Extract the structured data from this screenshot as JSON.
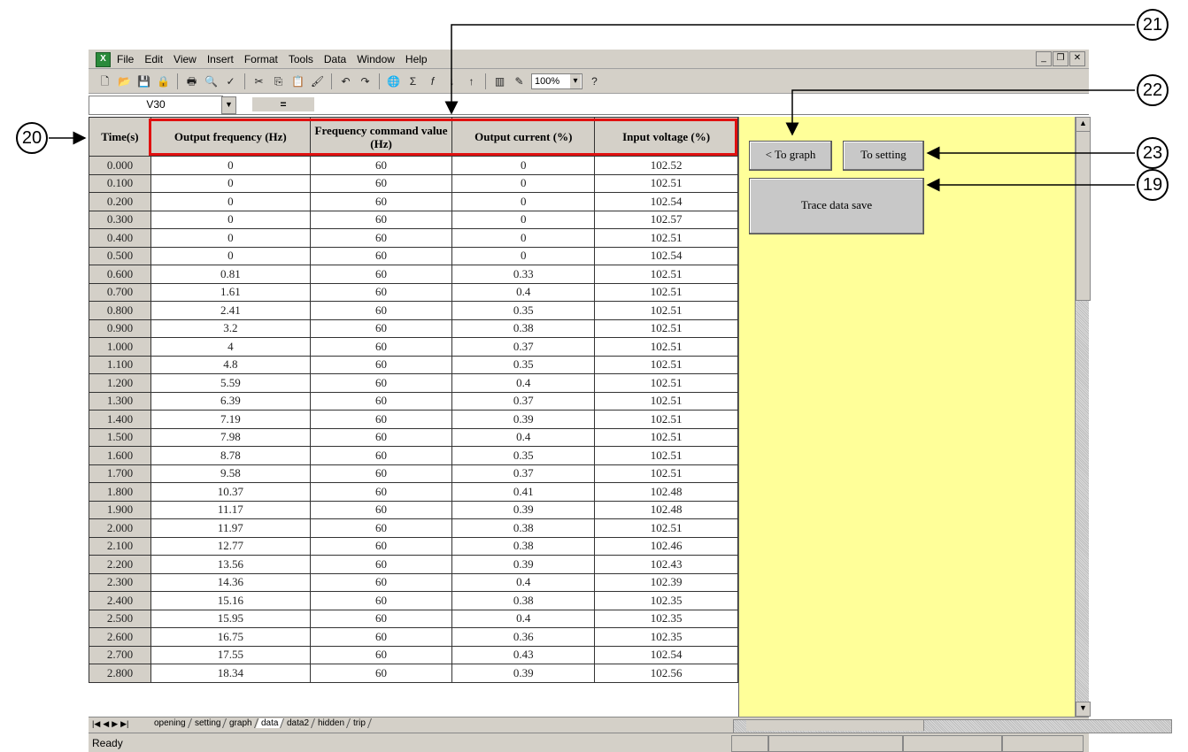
{
  "menubar": {
    "items": [
      "File",
      "Edit",
      "View",
      "Insert",
      "Format",
      "Tools",
      "Data",
      "Window",
      "Help"
    ]
  },
  "toolbar": {
    "icons": [
      "new-icon",
      "open-icon",
      "save-icon",
      "permission-icon",
      "print-icon",
      "print-preview-icon",
      "spelling-icon",
      "cut-icon",
      "copy-icon",
      "paste-icon",
      "format-painter-icon",
      "undo-icon",
      "redo-icon",
      "hyperlink-icon",
      "autosum-icon",
      "function-icon",
      "sort-ascending-icon",
      "sort-descending-icon",
      "chart-wizard-icon",
      "drawing-icon",
      "help-icon"
    ],
    "zoom": "100%"
  },
  "formula_bar": {
    "name_box": "V30",
    "equals": "="
  },
  "table": {
    "headers": [
      "Time(s)",
      "Output frequency (Hz)",
      "Frequency command value (Hz)",
      "Output current (%)",
      "Input voltage (%)"
    ],
    "rows": [
      [
        "0.000",
        "0",
        "60",
        "0",
        "102.52"
      ],
      [
        "0.100",
        "0",
        "60",
        "0",
        "102.51"
      ],
      [
        "0.200",
        "0",
        "60",
        "0",
        "102.54"
      ],
      [
        "0.300",
        "0",
        "60",
        "0",
        "102.57"
      ],
      [
        "0.400",
        "0",
        "60",
        "0",
        "102.51"
      ],
      [
        "0.500",
        "0",
        "60",
        "0",
        "102.54"
      ],
      [
        "0.600",
        "0.81",
        "60",
        "0.33",
        "102.51"
      ],
      [
        "0.700",
        "1.61",
        "60",
        "0.4",
        "102.51"
      ],
      [
        "0.800",
        "2.41",
        "60",
        "0.35",
        "102.51"
      ],
      [
        "0.900",
        "3.2",
        "60",
        "0.38",
        "102.51"
      ],
      [
        "1.000",
        "4",
        "60",
        "0.37",
        "102.51"
      ],
      [
        "1.100",
        "4.8",
        "60",
        "0.35",
        "102.51"
      ],
      [
        "1.200",
        "5.59",
        "60",
        "0.4",
        "102.51"
      ],
      [
        "1.300",
        "6.39",
        "60",
        "0.37",
        "102.51"
      ],
      [
        "1.400",
        "7.19",
        "60",
        "0.39",
        "102.51"
      ],
      [
        "1.500",
        "7.98",
        "60",
        "0.4",
        "102.51"
      ],
      [
        "1.600",
        "8.78",
        "60",
        "0.35",
        "102.51"
      ],
      [
        "1.700",
        "9.58",
        "60",
        "0.37",
        "102.51"
      ],
      [
        "1.800",
        "10.37",
        "60",
        "0.41",
        "102.48"
      ],
      [
        "1.900",
        "11.17",
        "60",
        "0.39",
        "102.48"
      ],
      [
        "2.000",
        "11.97",
        "60",
        "0.38",
        "102.51"
      ],
      [
        "2.100",
        "12.77",
        "60",
        "0.38",
        "102.46"
      ],
      [
        "2.200",
        "13.56",
        "60",
        "0.39",
        "102.43"
      ],
      [
        "2.300",
        "14.36",
        "60",
        "0.4",
        "102.39"
      ],
      [
        "2.400",
        "15.16",
        "60",
        "0.38",
        "102.35"
      ],
      [
        "2.500",
        "15.95",
        "60",
        "0.4",
        "102.35"
      ],
      [
        "2.600",
        "16.75",
        "60",
        "0.36",
        "102.35"
      ],
      [
        "2.700",
        "17.55",
        "60",
        "0.43",
        "102.54"
      ],
      [
        "2.800",
        "18.34",
        "60",
        "0.39",
        "102.56"
      ]
    ]
  },
  "panel": {
    "to_graph": "< To graph",
    "to_setting": "To setting",
    "trace_save": "Trace data save"
  },
  "sheet_tabs": [
    "opening",
    "setting",
    "graph",
    "data",
    "data2",
    "hidden",
    "trip"
  ],
  "active_tab": "data",
  "status": "Ready",
  "callouts": {
    "c19": "19",
    "c20": "20",
    "c21": "21",
    "c22": "22",
    "c23": "23"
  },
  "colors": {
    "highlight": "#e01010",
    "panel_bg": "#ffff99",
    "chrome": "#d4d0c8"
  }
}
